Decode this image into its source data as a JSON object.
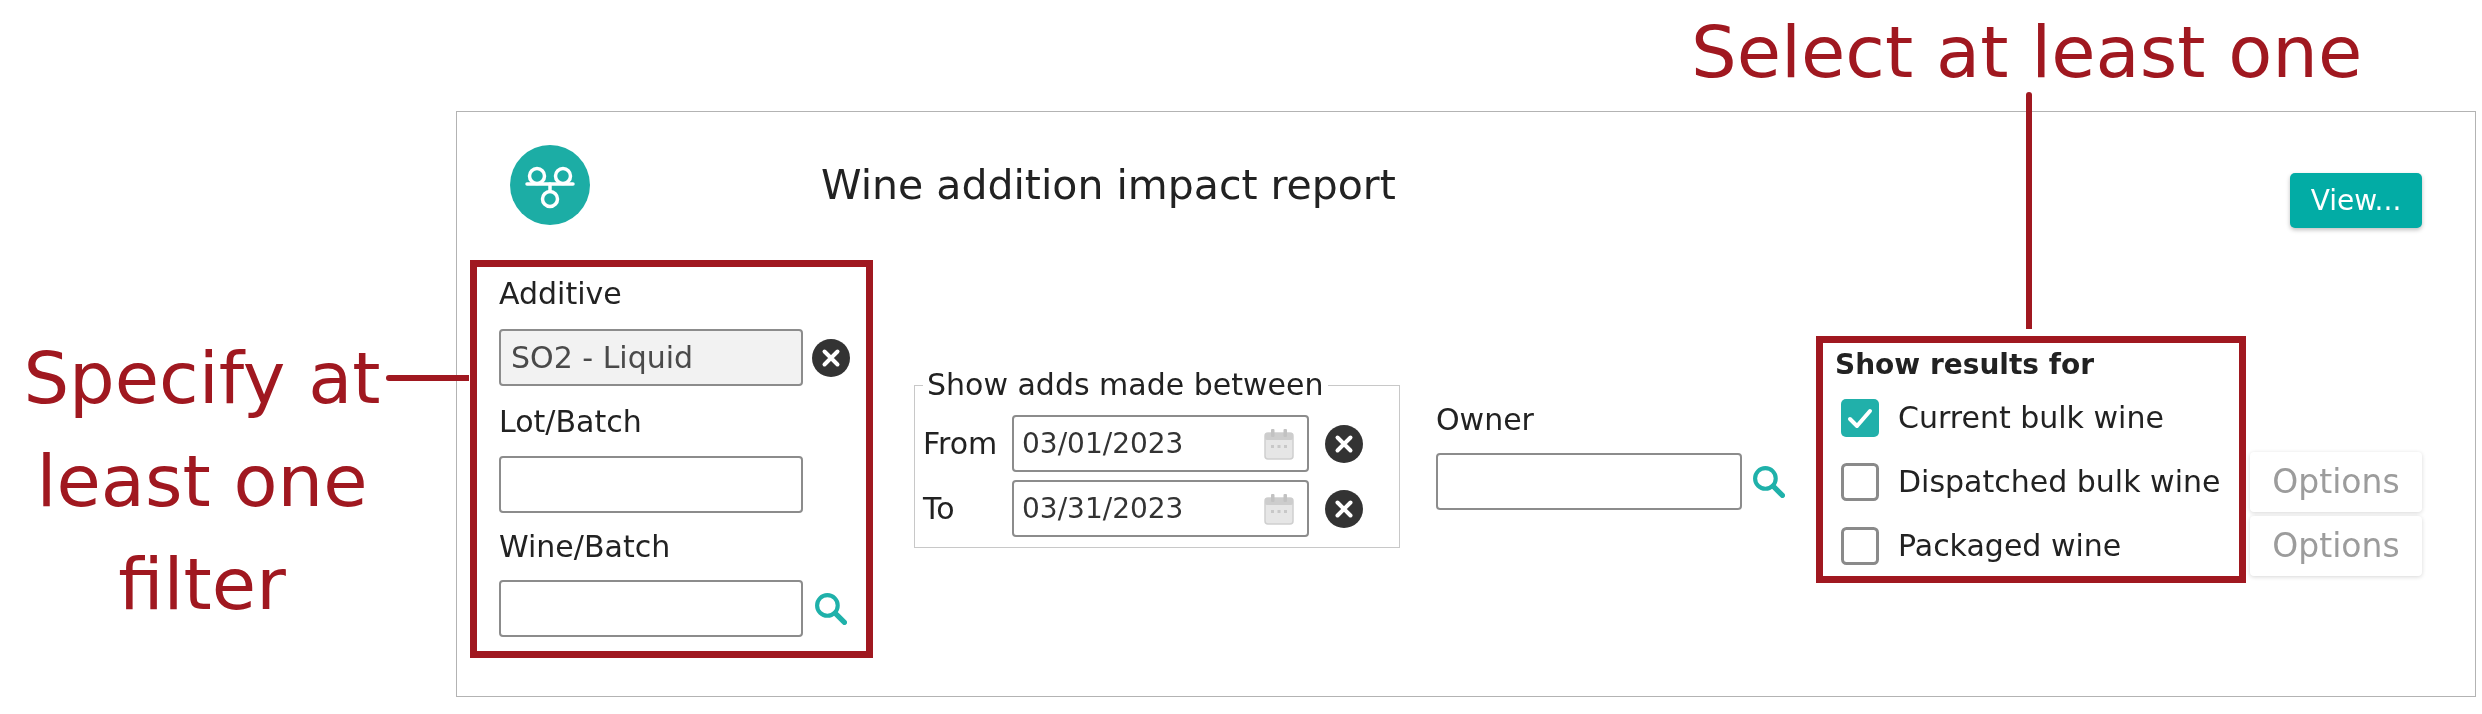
{
  "report": {
    "title": "Wine addition impact report",
    "view_button": "View..."
  },
  "filters": {
    "additive": {
      "label": "Additive",
      "value": "SO2 - Liquid",
      "readonly": true
    },
    "lot_batch": {
      "label": "Lot/Batch",
      "readonly": false
    },
    "wine_batch": {
      "label": "Wine/Batch",
      "readonly": false
    }
  },
  "date_range": {
    "legend": "Show adds made between",
    "from": {
      "label": "From",
      "value": "03/01/2023"
    },
    "to": {
      "label": "To",
      "value": "03/31/2023"
    }
  },
  "owner": {
    "label": "Owner"
  },
  "show_results": {
    "heading": "Show results for",
    "items": [
      {
        "label": "Current bulk wine",
        "checked": true
      },
      {
        "label": "Dispatched bulk wine",
        "checked": false,
        "options": {
          "label": "Options",
          "disabled": true
        }
      },
      {
        "label": "Packaged wine",
        "checked": false,
        "options": {
          "label": "Options",
          "disabled": true
        }
      }
    ]
  },
  "annotations": {
    "filters_note": "Specify at least one filter",
    "results_note": "Select at least one"
  }
}
